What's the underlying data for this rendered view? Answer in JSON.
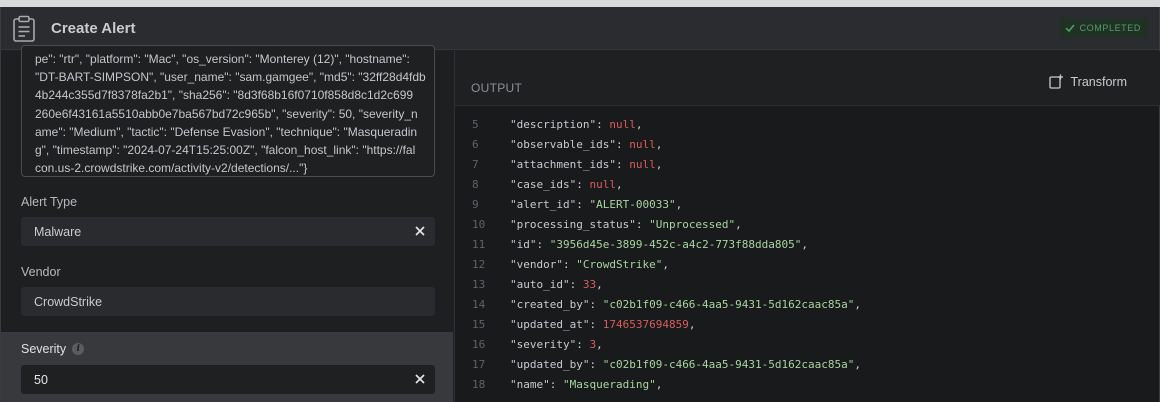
{
  "header": {
    "title": "Create Alert",
    "status": "COMPLETED"
  },
  "left": {
    "json_lines": [
      "pe\": \"rtr\", \"platform\": \"Mac\", \"os_version\": \"Monterey (12)\", \"hostname\":",
      "\"DT-BART-SIMPSON\", \"user_name\": \"sam.gamgee\", \"md5\": \"32ff28d4fdb",
      "4b244c355d7f8378fa2b1\", \"sha256\": \"8d3f68b16f0710f858d8c1d2c699",
      "260e6f43161a5510abb0e7ba567bd72c965b\", \"severity\": 50, \"severity_n",
      "ame\": \"Medium\", \"tactic\": \"Defense Evasion\", \"technique\": \"Masqueradin",
      "g\", \"timestamp\": \"2024-07-24T15:25:00Z\", \"falcon_host_link\": \"https://fal",
      "con.us-2.crowdstrike.com/activity-v2/detections/...\"}"
    ],
    "alert_type": {
      "label": "Alert Type",
      "value": "Malware"
    },
    "vendor": {
      "label": "Vendor",
      "value": "CrowdStrike"
    },
    "severity": {
      "label": "Severity",
      "value": "50"
    }
  },
  "output": {
    "title": "OUTPUT",
    "transform_label": "Transform",
    "lines": [
      {
        "n": "5",
        "key": "description",
        "value": "null",
        "type": "null"
      },
      {
        "n": "6",
        "key": "observable_ids",
        "value": "null",
        "type": "null"
      },
      {
        "n": "7",
        "key": "attachment_ids",
        "value": "null",
        "type": "null"
      },
      {
        "n": "8",
        "key": "case_ids",
        "value": "null",
        "type": "null"
      },
      {
        "n": "9",
        "key": "alert_id",
        "value": "ALERT-00033",
        "type": "string"
      },
      {
        "n": "10",
        "key": "processing_status",
        "value": "Unprocessed",
        "type": "string"
      },
      {
        "n": "11",
        "key": "id",
        "value": "3956d45e-3899-452c-a4c2-773f88dda805",
        "type": "string"
      },
      {
        "n": "12",
        "key": "vendor",
        "value": "CrowdStrike",
        "type": "string"
      },
      {
        "n": "13",
        "key": "auto_id",
        "value": "33",
        "type": "number"
      },
      {
        "n": "14",
        "key": "created_by",
        "value": "c02b1f09-c466-4aa5-9431-5d162caac85a",
        "type": "string"
      },
      {
        "n": "15",
        "key": "updated_at",
        "value": "1746537694859",
        "type": "number"
      },
      {
        "n": "16",
        "key": "severity",
        "value": "3",
        "type": "number"
      },
      {
        "n": "17",
        "key": "updated_by",
        "value": "c02b1f09-c466-4aa5-9431-5d162caac85a",
        "type": "string"
      },
      {
        "n": "18",
        "key": "name",
        "value": "Masquerading",
        "type": "string"
      }
    ]
  },
  "colors": {
    "string": "#a9d4a0",
    "number": "#d85c5c",
    "status_green": "#4f9e67"
  }
}
